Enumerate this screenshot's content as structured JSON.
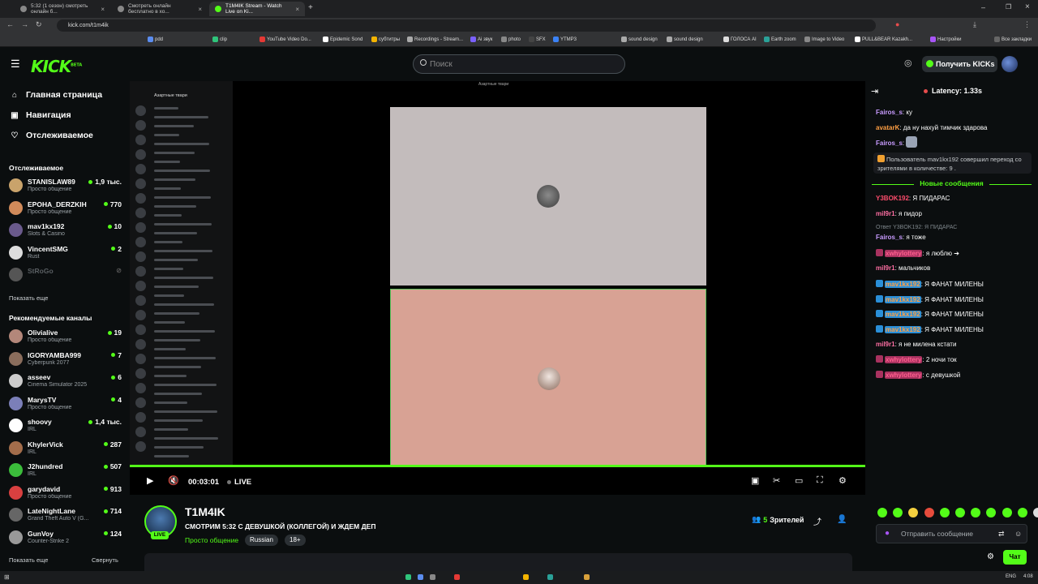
{
  "browser": {
    "tabs": [
      {
        "title": "5:32 (1 сезон) смотреть онлайн б..."
      },
      {
        "title": "Смотреть онлайн бесплатно в хо..."
      },
      {
        "title": "T1M4IK Stream - Watch Live on Ki..."
      }
    ],
    "url": "kick.com/t1m4ik",
    "bookmarks": [
      "pdd",
      "clip",
      "YouTube Video Do...",
      "Epidemic Sond",
      "субтитры",
      "Recordings - Stream...",
      "Ai звук",
      "photo",
      "SFX",
      "YTMP3",
      "sound design",
      "sound design",
      "ГОЛОСА AI",
      "Earth zoom",
      "Image to Video",
      "PULL&BEAR Kazakh...",
      "Настройки",
      "Все закладки"
    ]
  },
  "header": {
    "logo": "KICK",
    "logo_beta": "BETA",
    "search_placeholder": "Поиск",
    "get_kicks": "Получить KICKs"
  },
  "sidebar": {
    "nav": [
      {
        "label": "Главная страница",
        "icon": "home-icon"
      },
      {
        "label": "Навигация",
        "icon": "compass-icon"
      },
      {
        "label": "Отслеживаемое",
        "icon": "heart-icon"
      }
    ],
    "following_title": "Отслеживаемое",
    "following": [
      {
        "name": "STANISLAW89",
        "category": "Просто общение",
        "viewers": "1,9 тыс.",
        "color": "#c9a36b"
      },
      {
        "name": "EPOHA_DERZKIH",
        "category": "Просто общение",
        "viewers": "770",
        "color": "#d08a5a"
      },
      {
        "name": "mav1kx192",
        "category": "Slots & Casino",
        "viewers": "10",
        "color": "#6a5a8c"
      },
      {
        "name": "VincentSMG",
        "category": "Rust",
        "viewers": "2",
        "color": "#ddd"
      },
      {
        "name": "StRoGo",
        "category": "",
        "viewers": "",
        "color": "#555"
      }
    ],
    "show_more_1": "Показать еще",
    "recommended_title": "Рекомендуемые каналы",
    "recommended": [
      {
        "name": "Olivialive",
        "category": "Просто общение",
        "viewers": "19",
        "color": "#b3877a"
      },
      {
        "name": "IGORYAMBA999",
        "category": "Cyberpunk 2077",
        "viewers": "7",
        "color": "#8a6d5c"
      },
      {
        "name": "asseev",
        "category": "Cinema Simulator 2025",
        "viewers": "6",
        "color": "#ccc"
      },
      {
        "name": "MarysTV",
        "category": "Просто общение",
        "viewers": "4",
        "color": "#7b7fb8"
      },
      {
        "name": "shoovy",
        "category": "IRL",
        "viewers": "1,4 тыс.",
        "color": "#fff"
      },
      {
        "name": "KhylerVick",
        "category": "IRL",
        "viewers": "287",
        "color": "#a36d4b"
      },
      {
        "name": "J2hundred",
        "category": "IRL",
        "viewers": "507",
        "color": "#3bbd3b"
      },
      {
        "name": "garydavid",
        "category": "Просто общение",
        "viewers": "913",
        "color": "#d94040"
      },
      {
        "name": "LateNightLane",
        "category": "Grand Theft Auto V (G...",
        "viewers": "714",
        "color": "#666"
      },
      {
        "name": "GunVoy",
        "category": "Counter-Strike 2",
        "viewers": "124",
        "color": "#999"
      }
    ],
    "show_more_2": "Показать еще",
    "collapse": "Свернуть"
  },
  "player": {
    "discord_server": "Азартные твари",
    "time": "00:03:01",
    "live_label": "LIVE"
  },
  "stream": {
    "name": "T1M4IK",
    "live_badge": "LIVE",
    "title": "СМОТРИМ 5:32 С ДЕВУШКОЙ (КОЛЛЕГОЙ) И ЖДЕМ ДЕП",
    "category": "Просто общение",
    "tags": [
      "Russian",
      "18+"
    ],
    "viewers_count": "5",
    "viewers_label": "Зрителей"
  },
  "chat": {
    "latency": "Latency: 1.33s",
    "new_messages": "Новые сообщения",
    "system_message": "Пользователь mav1kx192 совершил переход со зрителями в количестве: 9 .",
    "messages_before": [
      {
        "user": "Fairos_s",
        "text": ": ку",
        "color": "#c89bff"
      },
      {
        "user": "avatarK",
        "text": ": да ну нахуй тимчик здарова",
        "color": "#ff9f43"
      },
      {
        "user": "Fairos_s",
        "text": ":",
        "color": "#c89bff"
      }
    ],
    "messages": [
      {
        "user": "Y3BOK192",
        "text": ": Я ПИДАРАС",
        "color": "#ff4d6d",
        "badge": ""
      },
      {
        "user": "mil9r1",
        "text": ": я пидор",
        "color": "#ff6fa3",
        "badge": ""
      },
      {
        "user": "Fairos_s",
        "text": ": я тоже",
        "color": "#c89bff",
        "badge": "",
        "reply": "Ответ Y3BOK192: Я ПИДАРАС"
      },
      {
        "user": "xwhylottery",
        "text": ": я люблю ➔",
        "color": "#ff5f8f",
        "badge": "#a8325f"
      },
      {
        "user": "mil9r1",
        "text": ": мальчиков",
        "color": "#ff6fa3",
        "badge": ""
      },
      {
        "user": "mav1kx192",
        "text": ": Я ФАНАТ МИЛЕНЫ",
        "color": "#ff9f43",
        "badge": "#2a8fd8"
      },
      {
        "user": "mav1kx192",
        "text": ": Я ФАНАТ МИЛЕНЫ",
        "color": "#ff9f43",
        "badge": "#2a8fd8"
      },
      {
        "user": "mav1kx192",
        "text": ": Я ФАНАТ МИЛЕНЫ",
        "color": "#ff9f43",
        "badge": "#2a8fd8"
      },
      {
        "user": "mav1kx192",
        "text": ": Я ФАНАТ МИЛЕНЫ",
        "color": "#ff9f43",
        "badge": "#2a8fd8"
      },
      {
        "user": "mil9r1",
        "text": ": я не милена кстати",
        "color": "#ff6fa3",
        "badge": ""
      },
      {
        "user": "xwhylottery",
        "text": ": 2 ночи ток",
        "color": "#ff5f8f",
        "badge": "#a8325f"
      },
      {
        "user": "xwhylottery",
        "text": ": с девушкой",
        "color": "#ff5f8f",
        "badge": "#a8325f"
      }
    ],
    "input_placeholder": "Отправить сообщение",
    "send_label": "Чат"
  },
  "taskbar": {
    "lang": "ENG",
    "time": "4:08"
  },
  "colors": {
    "accent": "#53fc18",
    "bg": "#0b0e0f",
    "panel": "#191b1f"
  }
}
